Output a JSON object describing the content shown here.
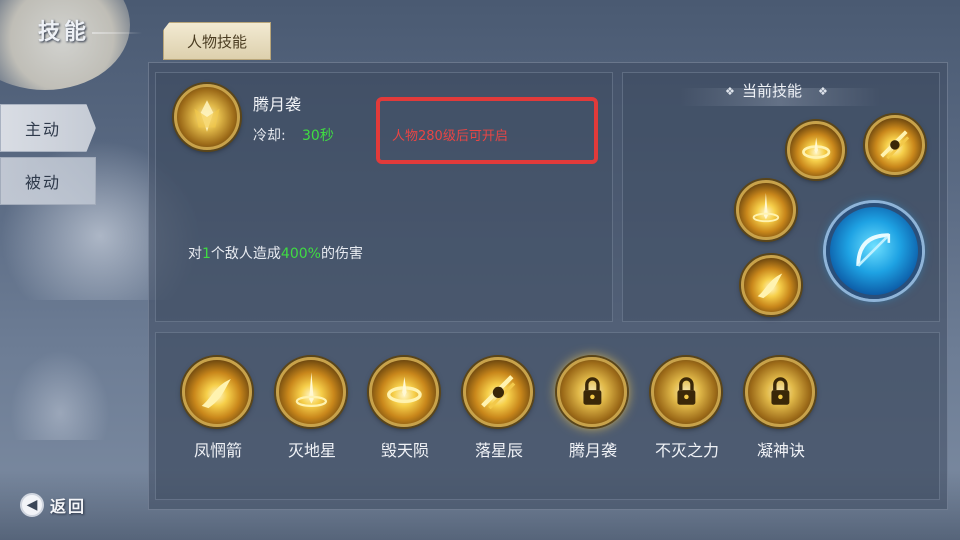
{
  "page": {
    "title": "技能"
  },
  "side_tabs": [
    {
      "label": "主动",
      "active": true
    },
    {
      "label": "被动",
      "active": false
    }
  ],
  "header_tab": {
    "label": "人物技能"
  },
  "selected_skill": {
    "name": "腾月袭",
    "cooldown_label": "冷却:",
    "cooldown_value": "30秒",
    "unlock_notice": "人物280级后可开启",
    "description": {
      "prefix": "对",
      "targets": "1",
      "middle": "个敌人造成",
      "damage": "400%",
      "suffix": "的伤害"
    }
  },
  "current_skills": {
    "title": "当前技能",
    "diamond": "❖",
    "slots": [
      {
        "icon": "ring-burst-icon"
      },
      {
        "icon": "crossed-blades-icon"
      },
      {
        "icon": "star-strike-icon"
      },
      {
        "icon": "flame-arrow-icon"
      }
    ],
    "attack_icon": "bow-icon"
  },
  "skill_list": [
    {
      "name": "凤惘箭",
      "icon": "flame-arrow-icon",
      "selected": false,
      "locked": false
    },
    {
      "name": "灭地星",
      "icon": "star-strike-icon",
      "selected": false,
      "locked": false
    },
    {
      "name": "毁天陨",
      "icon": "ring-burst-icon",
      "selected": false,
      "locked": false
    },
    {
      "name": "落星辰",
      "icon": "crossed-blades-icon",
      "selected": false,
      "locked": false
    },
    {
      "name": "腾月袭",
      "icon": "lock-icon",
      "selected": true,
      "locked": true
    },
    {
      "name": "不灭之力",
      "icon": "lock-icon",
      "selected": false,
      "locked": true
    },
    {
      "name": "凝神诀",
      "icon": "lock-icon",
      "selected": false,
      "locked": true
    }
  ],
  "back": {
    "label": "返回",
    "icon": "back-arrow-icon"
  },
  "colors": {
    "highlight_green": "#3fdc42",
    "warning_red": "#e84545",
    "gold": "#c8a24a",
    "attack_blue": "#1ea2e3"
  }
}
